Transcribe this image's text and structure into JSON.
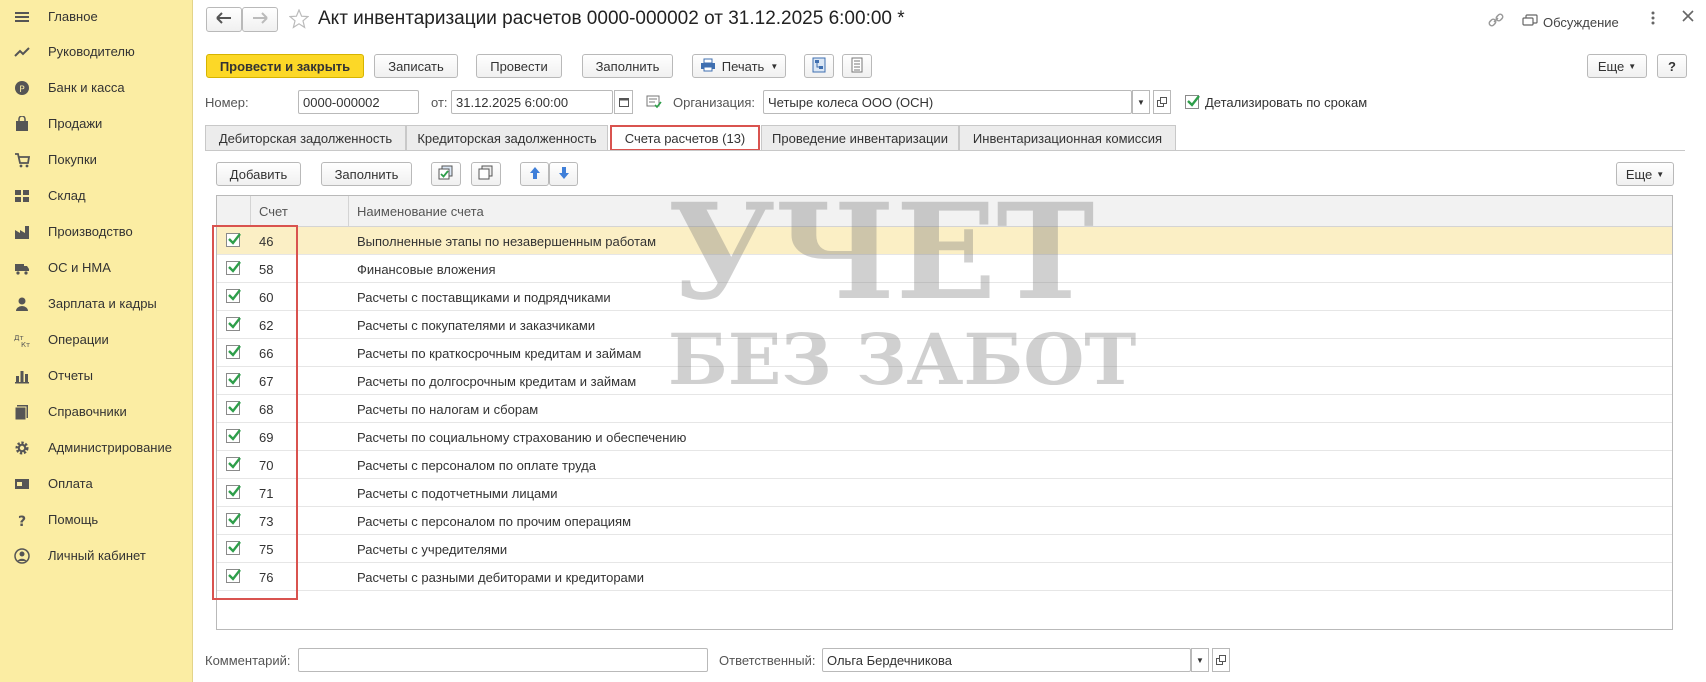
{
  "sidebar": {
    "items": [
      {
        "label": "Главное",
        "icon": "menu-icon"
      },
      {
        "label": "Руководителю",
        "icon": "trend-icon"
      },
      {
        "label": "Банк и касса",
        "icon": "coin-icon"
      },
      {
        "label": "Продажи",
        "icon": "bag-icon"
      },
      {
        "label": "Покупки",
        "icon": "cart-icon"
      },
      {
        "label": "Склад",
        "icon": "grid-icon"
      },
      {
        "label": "Производство",
        "icon": "factory-icon"
      },
      {
        "label": "ОС и НМА",
        "icon": "truck-icon"
      },
      {
        "label": "Зарплата и кадры",
        "icon": "person-icon"
      },
      {
        "label": "Операции",
        "icon": "dt-kt-icon"
      },
      {
        "label": "Отчеты",
        "icon": "bar-chart-icon"
      },
      {
        "label": "Справочники",
        "icon": "books-icon"
      },
      {
        "label": "Администрирование",
        "icon": "gear-icon"
      },
      {
        "label": "Оплата",
        "icon": "card-icon"
      },
      {
        "label": "Помощь",
        "icon": "question-icon"
      },
      {
        "label": "Личный кабинет",
        "icon": "account-icon"
      }
    ]
  },
  "header": {
    "title": "Акт инвентаризации расчетов 0000-000002 от 31.12.2025 6:00:00 *",
    "discussion_label": "Обсуждение"
  },
  "toolbar": {
    "post_close": "Провести и закрыть",
    "save": "Записать",
    "post": "Провести",
    "fill": "Заполнить",
    "print": "Печать",
    "more": "Еще",
    "help": "?"
  },
  "form": {
    "number_label": "Номер:",
    "number_value": "0000-000002",
    "date_label": "от:",
    "date_value": "31.12.2025  6:00:00",
    "org_label": "Организация:",
    "org_value": "Четыре колеса ООО (ОСН)",
    "detail_label": "Детализировать по срокам",
    "detail_checked": true,
    "comment_label": "Комментарий:",
    "comment_value": "",
    "responsible_label": "Ответственный:",
    "responsible_value": "Ольга Бердечникова"
  },
  "tabs": [
    "Дебиторская задолженность",
    "Кредиторская задолженность",
    "Счета расчетов (13)",
    "Проведение инвентаризации",
    "Инвентаризационная комиссия"
  ],
  "active_tab": 2,
  "table_toolbar": {
    "add": "Добавить",
    "fill": "Заполнить",
    "more": "Еще"
  },
  "table": {
    "headers": {
      "account": "Счет",
      "name": "Наименование счета"
    },
    "rows": [
      {
        "checked": true,
        "account": "46",
        "name": "Выполненные этапы по незавершенным работам"
      },
      {
        "checked": true,
        "account": "58",
        "name": "Финансовые вложения"
      },
      {
        "checked": true,
        "account": "60",
        "name": "Расчеты с поставщиками и подрядчиками"
      },
      {
        "checked": true,
        "account": "62",
        "name": "Расчеты с покупателями и заказчиками"
      },
      {
        "checked": true,
        "account": "66",
        "name": "Расчеты по краткосрочным кредитам и займам"
      },
      {
        "checked": true,
        "account": "67",
        "name": "Расчеты по долгосрочным кредитам и займам"
      },
      {
        "checked": true,
        "account": "68",
        "name": "Расчеты по налогам и сборам"
      },
      {
        "checked": true,
        "account": "69",
        "name": "Расчеты по социальному страхованию и обеспечению"
      },
      {
        "checked": true,
        "account": "70",
        "name": "Расчеты с персоналом по оплате труда"
      },
      {
        "checked": true,
        "account": "71",
        "name": "Расчеты с подотчетными лицами"
      },
      {
        "checked": true,
        "account": "73",
        "name": "Расчеты с персоналом по прочим операциям"
      },
      {
        "checked": true,
        "account": "75",
        "name": "Расчеты с учредителями"
      },
      {
        "checked": true,
        "account": "76",
        "name": "Расчеты с разными дебиторами и кредиторами"
      }
    ]
  },
  "watermark": {
    "line1": "УЧЕТ",
    "line2": "БЕЗ ЗАБОТ"
  },
  "colors": {
    "sidebar": "#fbeda3",
    "primary_button": "#fcd827",
    "highlight_border": "#d9534f",
    "selected_row": "#fbefc5",
    "check_green": "#2e9e4a",
    "arrow_blue": "#3f7fd9"
  }
}
